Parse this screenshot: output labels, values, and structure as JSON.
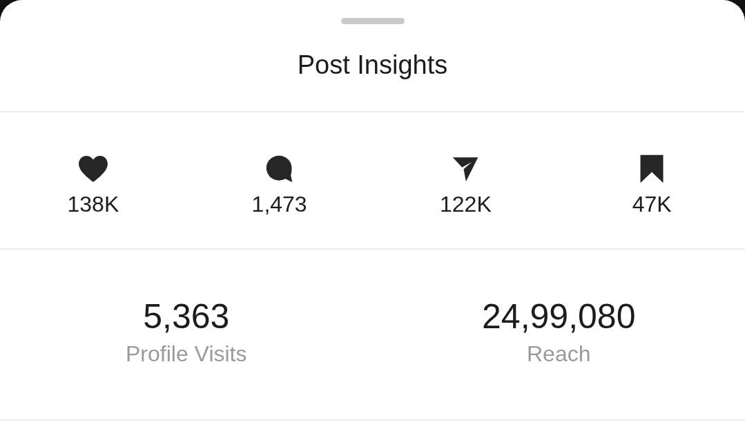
{
  "sheet": {
    "title": "Post Insights"
  },
  "interactions": [
    {
      "kind": "likes",
      "value": "138K"
    },
    {
      "kind": "comments",
      "value": "1,473"
    },
    {
      "kind": "shares",
      "value": "122K"
    },
    {
      "kind": "saves",
      "value": "47K"
    }
  ],
  "metrics": [
    {
      "value": "5,363",
      "label": "Profile Visits"
    },
    {
      "value": "24,99,080",
      "label": "Reach"
    }
  ]
}
